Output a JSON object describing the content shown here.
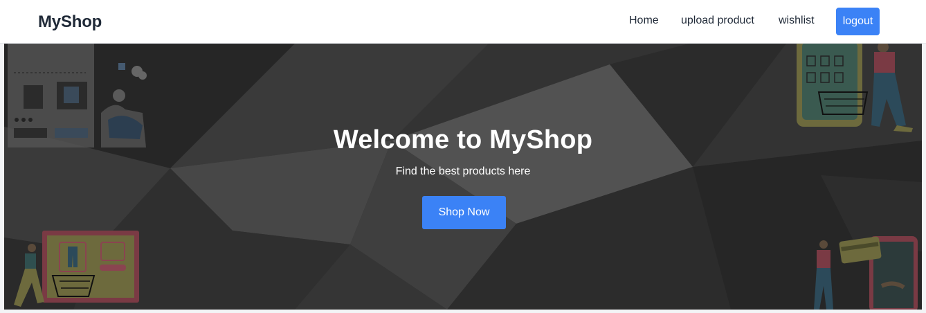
{
  "navbar": {
    "brand": "MyShop",
    "links": {
      "home": "Home",
      "upload": "upload product",
      "wishlist": "wishlist"
    },
    "logout_label": "logout"
  },
  "hero": {
    "title": "Welcome to MyShop",
    "subtitle": "Find the best products here",
    "cta_label": "Shop Now"
  },
  "colors": {
    "accent": "#3b82f6",
    "hero_background": "#2f2f2f",
    "nav_text": "#1f2937"
  },
  "icons": [
    "shopping-cart-icon",
    "shopping-illustration",
    "payment-card-illustration"
  ]
}
